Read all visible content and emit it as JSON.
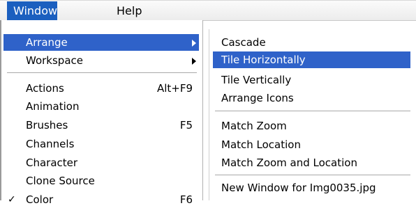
{
  "menubar": {
    "items": [
      {
        "label": "Window"
      },
      {
        "label": "Help"
      }
    ]
  },
  "window_menu": {
    "items": [
      {
        "label": "Arrange",
        "shortcut": ""
      },
      {
        "label": "Workspace",
        "shortcut": ""
      },
      {
        "label": "Actions",
        "shortcut": "Alt+F9"
      },
      {
        "label": "Animation",
        "shortcut": ""
      },
      {
        "label": "Brushes",
        "shortcut": "F5"
      },
      {
        "label": "Channels",
        "shortcut": ""
      },
      {
        "label": "Character",
        "shortcut": ""
      },
      {
        "label": "Clone Source",
        "shortcut": ""
      },
      {
        "label": "Color",
        "shortcut": "F6",
        "checked": "✓"
      }
    ]
  },
  "arrange_menu": {
    "items": [
      {
        "label": "Cascade"
      },
      {
        "label": "Tile Horizontally"
      },
      {
        "label": "Tile Vertically"
      },
      {
        "label": "Arrange Icons"
      },
      {
        "label": "Match Zoom"
      },
      {
        "label": "Match Location"
      },
      {
        "label": "Match Zoom and Location"
      },
      {
        "label": "New Window for Img0035.jpg"
      }
    ]
  },
  "icons": {
    "submenu_arrow": "chevron-right-icon",
    "check": "checkmark-icon"
  },
  "colors": {
    "highlight": "#2f62c9",
    "menubar_active": "#1b5fbf"
  }
}
